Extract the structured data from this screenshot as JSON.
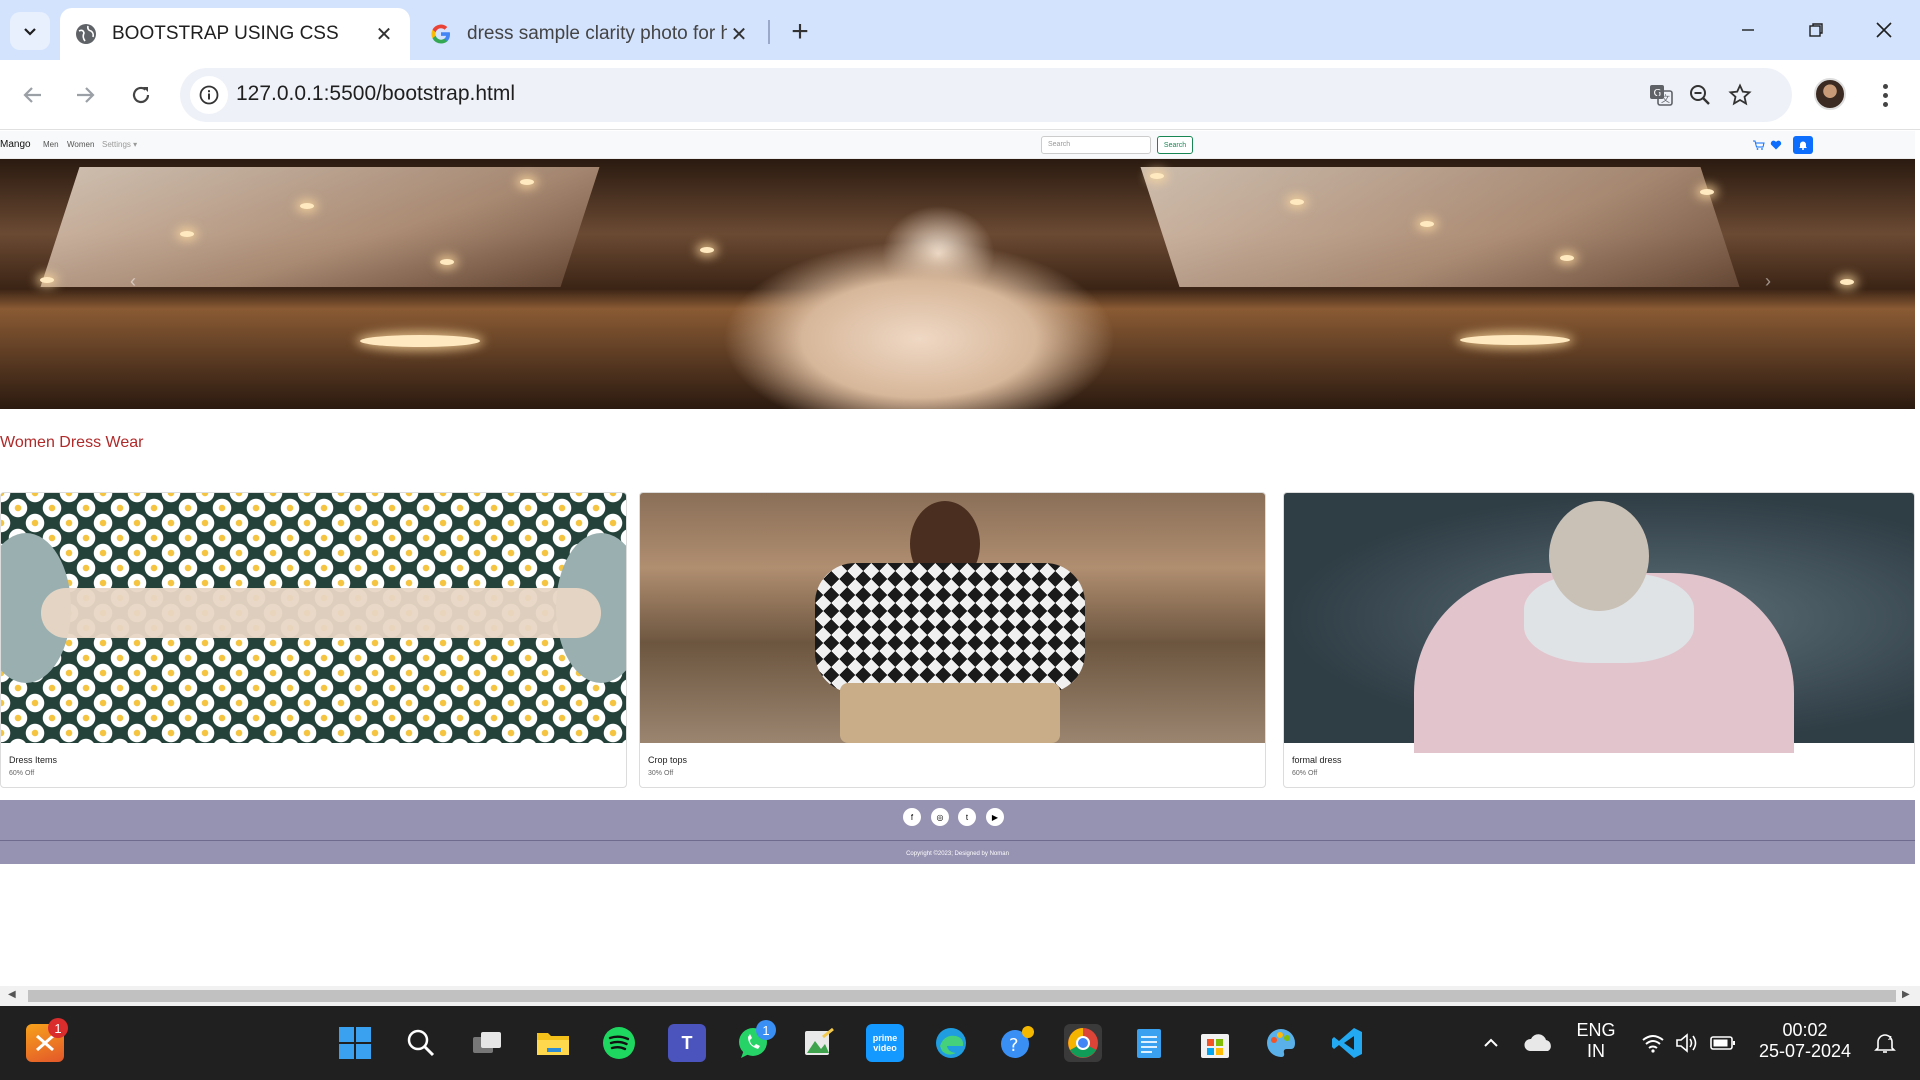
{
  "browser": {
    "tabs": [
      {
        "title": "BOOTSTRAP USING CSS",
        "active": true
      },
      {
        "title": "dress sample clarity photo for h",
        "active": false
      }
    ],
    "url": "127.0.0.1:5500/bootstrap.html"
  },
  "site": {
    "brand": "Mango",
    "nav": [
      "Men",
      "Women",
      "Settings"
    ],
    "search_placeholder": "Search",
    "search_button": "Search",
    "section_title": "Women Dress Wear",
    "cards": [
      {
        "name": "Dress Items",
        "offer": "60% Off"
      },
      {
        "name": "Crop tops",
        "offer": "30% Off"
      },
      {
        "name": "formal dress",
        "offer": "60% Off"
      }
    ],
    "footer": {
      "copyright": "Copyright ©2023; Designed by Noman"
    }
  },
  "taskbar": {
    "badges": {
      "xampp": "1",
      "whatsapp": "1"
    },
    "lang_line1": "ENG",
    "lang_line2": "IN",
    "time": "00:02",
    "date": "25-07-2024"
  },
  "colors": {
    "tabstrip": "#d3e3fd",
    "section_title": "#b02a2a",
    "footer": "#9692b1",
    "search_btn": "#198754",
    "bell_btn": "#0d6efd",
    "taskbar": "#202020"
  }
}
